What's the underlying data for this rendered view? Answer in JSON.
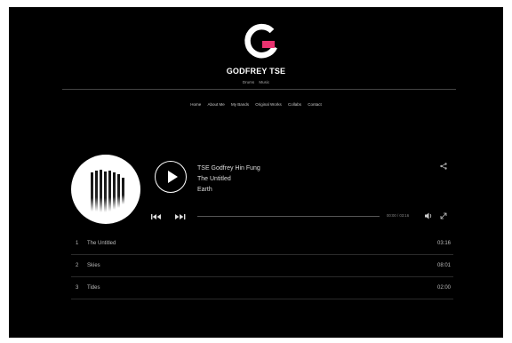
{
  "site": {
    "name": "GODFREY TSE",
    "tagline": [
      "Drums",
      "Music"
    ],
    "accent": "#e8326f"
  },
  "nav": {
    "items": [
      "Home",
      "About Me",
      "My Bands",
      "Original Works",
      "Collabs",
      "Contact"
    ]
  },
  "player": {
    "artist": "TSE Godfrey Hin Fung",
    "album": "The Untitled",
    "track": "Earth",
    "time": "00:00 / 03:16",
    "icons": [
      "play-icon",
      "share-icon",
      "rewind-icon",
      "fast-forward-icon",
      "volume-icon",
      "expand-icon"
    ]
  },
  "tracklist": [
    {
      "num": "1",
      "title": "The Untitled",
      "duration": "03:16"
    },
    {
      "num": "2",
      "title": "Skies",
      "duration": "08:01"
    },
    {
      "num": "3",
      "title": "Tides",
      "duration": "02:00"
    }
  ]
}
